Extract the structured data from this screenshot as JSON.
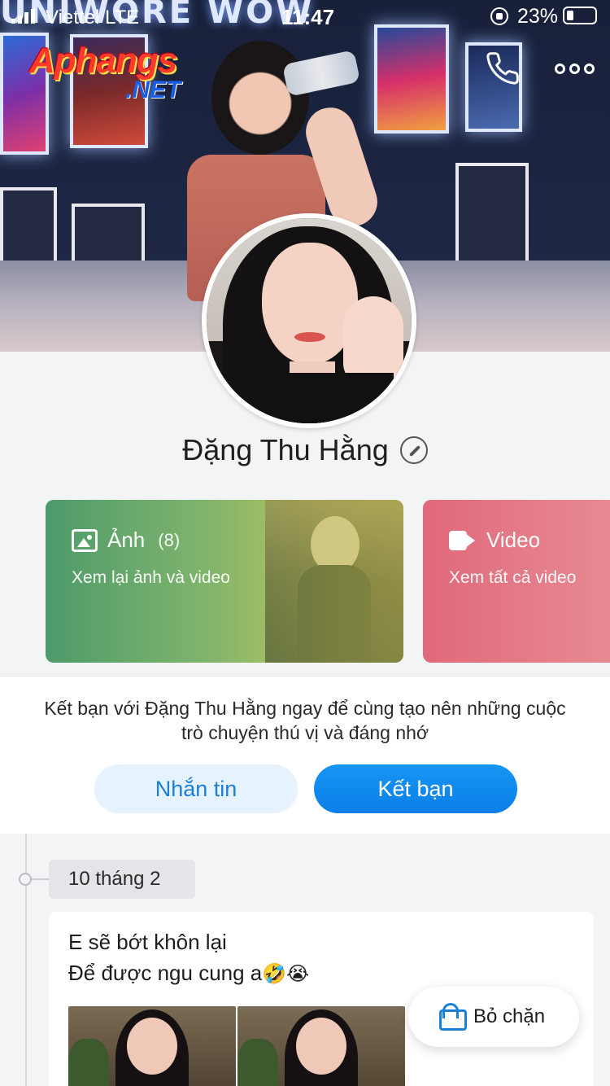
{
  "status_bar": {
    "carrier": "Viettel  LTE",
    "time": "11:47",
    "battery": "23%"
  },
  "watermark": {
    "line1": "Aphangs",
    "line2": ".NET"
  },
  "cover": {
    "marquee_text": "UNIWORE WOW"
  },
  "profile": {
    "name": "Đặng Thu Hằng"
  },
  "media_cards": {
    "photos": {
      "title": "Ảnh",
      "count": "(8)",
      "subtitle": "Xem lại ảnh và video"
    },
    "videos": {
      "title": "Video",
      "subtitle": "Xem tất cả video"
    }
  },
  "friend_prompt": {
    "text": "Kết bạn với Đặng Thu Hằng ngay để cùng tạo nên những cuộc trò chuyện thú vị và đáng nhớ",
    "message_label": "Nhắn tin",
    "add_friend_label": "Kết bạn"
  },
  "timeline": {
    "date": "10 tháng 2",
    "post": {
      "line1": "E sẽ bớt khôn lại",
      "line2": "Để được ngu cung a",
      "emojis": "🤣😭"
    }
  },
  "unblock": {
    "label": "Bỏ chặn"
  },
  "colors": {
    "accent": "#0a7fe8",
    "photos_card": "#4c9a6a",
    "videos_card": "#e0697a"
  }
}
